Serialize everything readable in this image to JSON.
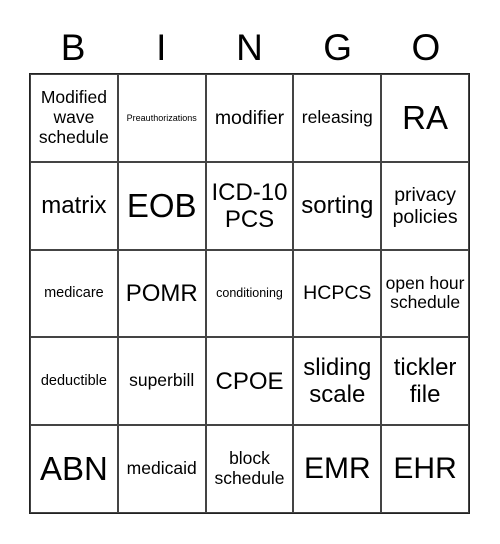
{
  "header": {
    "letters": [
      "B",
      "I",
      "N",
      "G",
      "O"
    ]
  },
  "cells": [
    [
      "Modified wave schedule",
      "Preauthorizations",
      "modifier",
      "releasing",
      "RA"
    ],
    [
      "matrix",
      "EOB",
      "ICD-10 PCS",
      "sorting",
      "privacy policies"
    ],
    [
      "medicare",
      "POMR",
      "conditioning",
      "HCPCS",
      "open hour schedule"
    ],
    [
      "deductible",
      "superbill",
      "CPOE",
      "sliding scale",
      "tickler file"
    ],
    [
      "ABN",
      "medicaid",
      "block schedule",
      "EMR",
      "EHR"
    ]
  ]
}
